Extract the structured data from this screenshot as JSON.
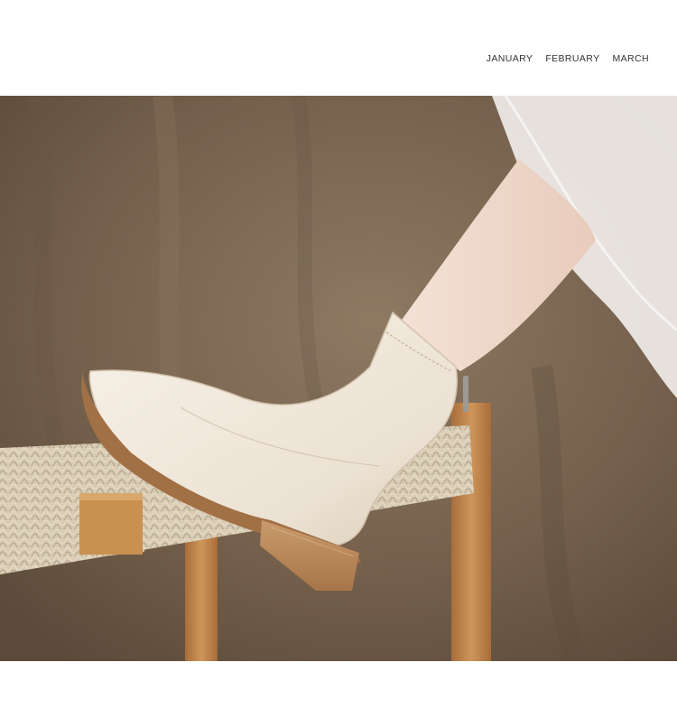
{
  "nav": {
    "items": [
      {
        "label": "JANUARY"
      },
      {
        "label": "FEBRUARY"
      },
      {
        "label": "MARCH"
      }
    ]
  },
  "photo": {
    "subject": "ankle-boot-photo"
  },
  "colors": {
    "background": "#ffffff",
    "backdrop": "#7d6a55",
    "boot": "#efe6d8",
    "heel": "#b98b5e",
    "bench_wood": "#c78c52",
    "rope": "#d9cdb7",
    "skirt": "#f3efec",
    "skin": "#f2ddd0"
  }
}
